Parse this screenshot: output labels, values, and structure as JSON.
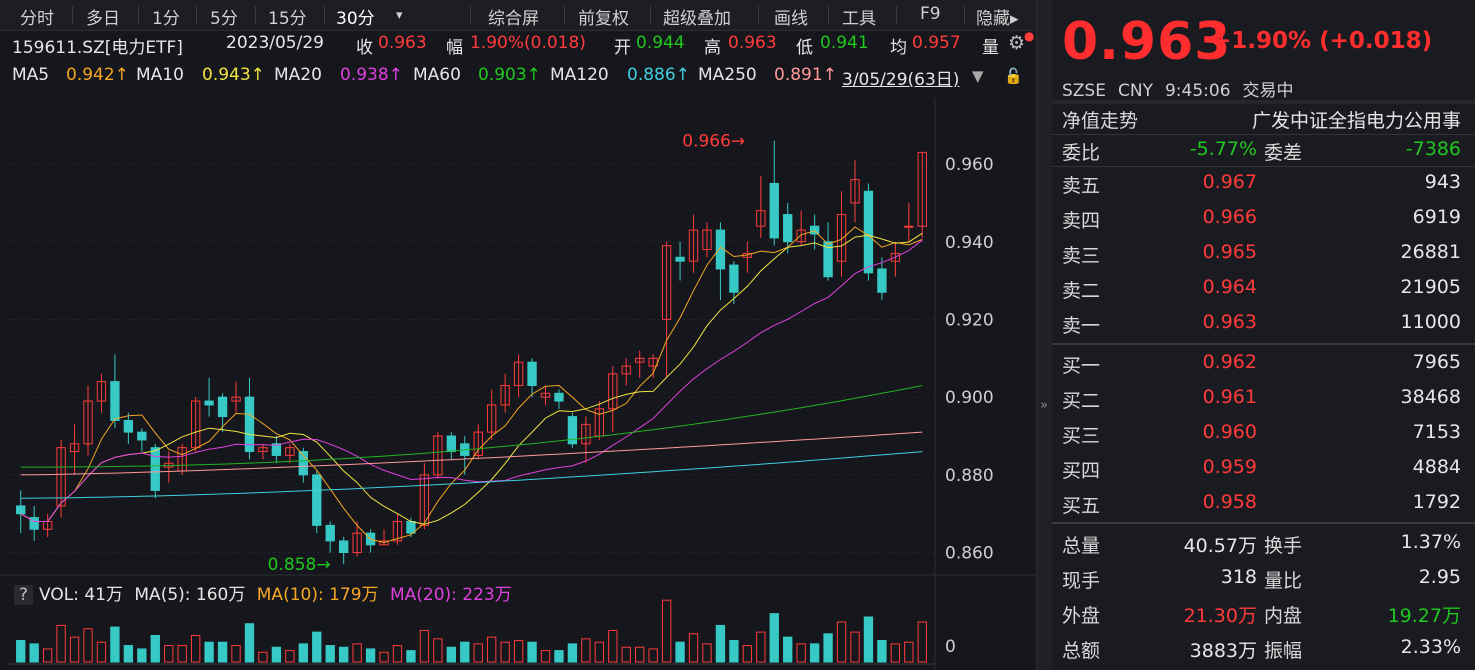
{
  "toolbar": {
    "items": [
      "分时",
      "多日",
      "1分",
      "5分",
      "15分",
      "30分",
      "▾",
      "综合屏",
      "前复权",
      "超级叠加",
      "画线",
      "工具",
      "F9",
      "隐藏▸"
    ]
  },
  "info": {
    "code": "159611.SZ[电力ETF]",
    "date": "2023/05/29",
    "close_label": "收",
    "close": "0.963",
    "amp_label": "幅",
    "amp": "1.90%(0.018)",
    "open_label": "开",
    "open": "0.944",
    "high_label": "高",
    "high": "0.963",
    "low_label": "低",
    "low": "0.941",
    "avg_label": "均",
    "avg": "0.957",
    "vol_label": "量"
  },
  "ma": {
    "ma5_label": "MA5",
    "ma5": "0.942↑",
    "ma10_label": "MA10",
    "ma10": "0.943↑",
    "ma20_label": "MA20",
    "ma20": "0.938↑",
    "ma60_label": "MA60",
    "ma60": "0.903↑",
    "ma120_label": "MA120",
    "ma120": "0.886↑",
    "ma250_label": "MA250",
    "ma250": "0.891↑",
    "range": "3/05/29(63日)"
  },
  "annotations": {
    "high_mark": "0.966",
    "low_mark": "0.858"
  },
  "vol": {
    "q": "?",
    "vol": "VOL: 41万",
    "ma5": "MA(5): 160万",
    "ma10": "MA(10): 179万",
    "ma20": "MA(20): 223万",
    "zero": "0"
  },
  "colors": {
    "up": "#ff3b3b",
    "down": "#36c9c6",
    "ma5": "#f5a623",
    "ma10": "#f0e442",
    "ma20": "#e040e0",
    "ma60": "#1fb51f",
    "ma120": "#40d0e0",
    "ma250": "#ff9a9a"
  },
  "chart_data": {
    "type": "candlestick",
    "ylabels": [
      "0.960",
      "0.940",
      "0.920",
      "0.900",
      "0.880",
      "0.860"
    ],
    "ylim": [
      0.855,
      0.977
    ],
    "candles": [
      [
        0.872,
        0.87,
        0.876,
        0.865
      ],
      [
        0.869,
        0.866,
        0.872,
        0.863
      ],
      [
        0.866,
        0.868,
        0.87,
        0.864
      ],
      [
        0.872,
        0.887,
        0.889,
        0.869
      ],
      [
        0.886,
        0.888,
        0.893,
        0.88
      ],
      [
        0.888,
        0.899,
        0.903,
        0.885
      ],
      [
        0.899,
        0.904,
        0.906,
        0.896
      ],
      [
        0.904,
        0.894,
        0.911,
        0.892
      ],
      [
        0.894,
        0.891,
        0.896,
        0.888
      ],
      [
        0.891,
        0.889,
        0.892,
        0.886
      ],
      [
        0.887,
        0.876,
        0.888,
        0.874
      ],
      [
        0.882,
        0.883,
        0.886,
        0.878
      ],
      [
        0.881,
        0.887,
        0.888,
        0.88
      ],
      [
        0.887,
        0.899,
        0.9,
        0.886
      ],
      [
        0.899,
        0.898,
        0.905,
        0.895
      ],
      [
        0.9,
        0.895,
        0.901,
        0.891
      ],
      [
        0.899,
        0.9,
        0.904,
        0.896
      ],
      [
        0.9,
        0.886,
        0.905,
        0.884
      ],
      [
        0.886,
        0.887,
        0.888,
        0.884
      ],
      [
        0.888,
        0.885,
        0.89,
        0.883
      ],
      [
        0.885,
        0.887,
        0.888,
        0.883
      ],
      [
        0.886,
        0.88,
        0.887,
        0.878
      ],
      [
        0.88,
        0.867,
        0.881,
        0.865
      ],
      [
        0.867,
        0.863,
        0.868,
        0.86
      ],
      [
        0.863,
        0.86,
        0.864,
        0.857
      ],
      [
        0.86,
        0.865,
        0.868,
        0.859
      ],
      [
        0.865,
        0.862,
        0.866,
        0.86
      ],
      [
        0.862,
        0.863,
        0.866,
        0.862
      ],
      [
        0.863,
        0.868,
        0.87,
        0.862
      ],
      [
        0.868,
        0.865,
        0.869,
        0.864
      ],
      [
        0.867,
        0.88,
        0.883,
        0.866
      ],
      [
        0.88,
        0.89,
        0.891,
        0.879
      ],
      [
        0.89,
        0.886,
        0.891,
        0.884
      ],
      [
        0.888,
        0.885,
        0.89,
        0.88
      ],
      [
        0.885,
        0.891,
        0.893,
        0.884
      ],
      [
        0.891,
        0.898,
        0.902,
        0.889
      ],
      [
        0.898,
        0.903,
        0.906,
        0.896
      ],
      [
        0.903,
        0.909,
        0.911,
        0.9
      ],
      [
        0.909,
        0.903,
        0.91,
        0.9
      ],
      [
        0.9,
        0.901,
        0.903,
        0.898
      ],
      [
        0.901,
        0.899,
        0.902,
        0.897
      ],
      [
        0.895,
        0.888,
        0.896,
        0.887
      ],
      [
        0.888,
        0.893,
        0.895,
        0.883
      ],
      [
        0.89,
        0.897,
        0.899,
        0.889
      ],
      [
        0.897,
        0.906,
        0.908,
        0.891
      ],
      [
        0.906,
        0.908,
        0.91,
        0.903
      ],
      [
        0.909,
        0.91,
        0.912,
        0.905
      ],
      [
        0.908,
        0.91,
        0.911,
        0.905
      ],
      [
        0.92,
        0.939,
        0.94,
        0.905
      ],
      [
        0.936,
        0.935,
        0.94,
        0.93
      ],
      [
        0.935,
        0.943,
        0.947,
        0.932
      ],
      [
        0.938,
        0.943,
        0.945,
        0.936
      ],
      [
        0.943,
        0.933,
        0.945,
        0.925
      ],
      [
        0.934,
        0.927,
        0.935,
        0.924
      ],
      [
        0.936,
        0.937,
        0.94,
        0.932
      ],
      [
        0.944,
        0.948,
        0.957,
        0.941
      ],
      [
        0.955,
        0.941,
        0.966,
        0.939
      ],
      [
        0.947,
        0.94,
        0.95,
        0.937
      ],
      [
        0.94,
        0.943,
        0.948,
        0.939
      ],
      [
        0.944,
        0.942,
        0.947,
        0.938
      ],
      [
        0.94,
        0.931,
        0.945,
        0.93
      ],
      [
        0.935,
        0.947,
        0.953,
        0.931
      ],
      [
        0.95,
        0.956,
        0.961,
        0.945
      ],
      [
        0.953,
        0.932,
        0.955,
        0.93
      ],
      [
        0.933,
        0.927,
        0.936,
        0.925
      ],
      [
        0.935,
        0.937,
        0.94,
        0.931
      ],
      [
        0.944,
        0.944,
        0.95,
        0.94
      ],
      [
        0.944,
        0.963,
        0.963,
        0.941
      ]
    ]
  },
  "right": {
    "price": "0.963",
    "change": "+1.90% (+0.018)",
    "exchange": "SZSE",
    "currency": "CNY",
    "time": "9:45:06",
    "status": "交易中",
    "nav_label": "净值走势",
    "index_name": "广发中证全指电力公用事",
    "wb_label": "委比",
    "wb": "-5.77%",
    "wc_label": "委差",
    "wc": "-7386",
    "sells": [
      {
        "label": "卖五",
        "price": "0.967",
        "vol": "943"
      },
      {
        "label": "卖四",
        "price": "0.966",
        "vol": "6919"
      },
      {
        "label": "卖三",
        "price": "0.965",
        "vol": "26881"
      },
      {
        "label": "卖二",
        "price": "0.964",
        "vol": "21905"
      },
      {
        "label": "卖一",
        "price": "0.963",
        "vol": "11000"
      }
    ],
    "buys": [
      {
        "label": "买一",
        "price": "0.962",
        "vol": "7965"
      },
      {
        "label": "买二",
        "price": "0.961",
        "vol": "38468"
      },
      {
        "label": "买三",
        "price": "0.960",
        "vol": "7153"
      },
      {
        "label": "买四",
        "price": "0.959",
        "vol": "4884"
      },
      {
        "label": "买五",
        "price": "0.958",
        "vol": "1792"
      }
    ],
    "stats": [
      {
        "l1": "总量",
        "v1": "40.57万",
        "l2": "换手",
        "v2": "1.37%",
        "c1": "white",
        "c2": "white"
      },
      {
        "l1": "现手",
        "v1": "318",
        "l2": "量比",
        "v2": "2.95",
        "c1": "white",
        "c2": "white"
      },
      {
        "l1": "外盘",
        "v1": "21.30万",
        "l2": "内盘",
        "v2": "19.27万",
        "c1": "red",
        "c2": "green"
      },
      {
        "l1": "总额",
        "v1": "3883万",
        "l2": "振幅",
        "v2": "2.33%",
        "c1": "white",
        "c2": "white"
      }
    ]
  }
}
